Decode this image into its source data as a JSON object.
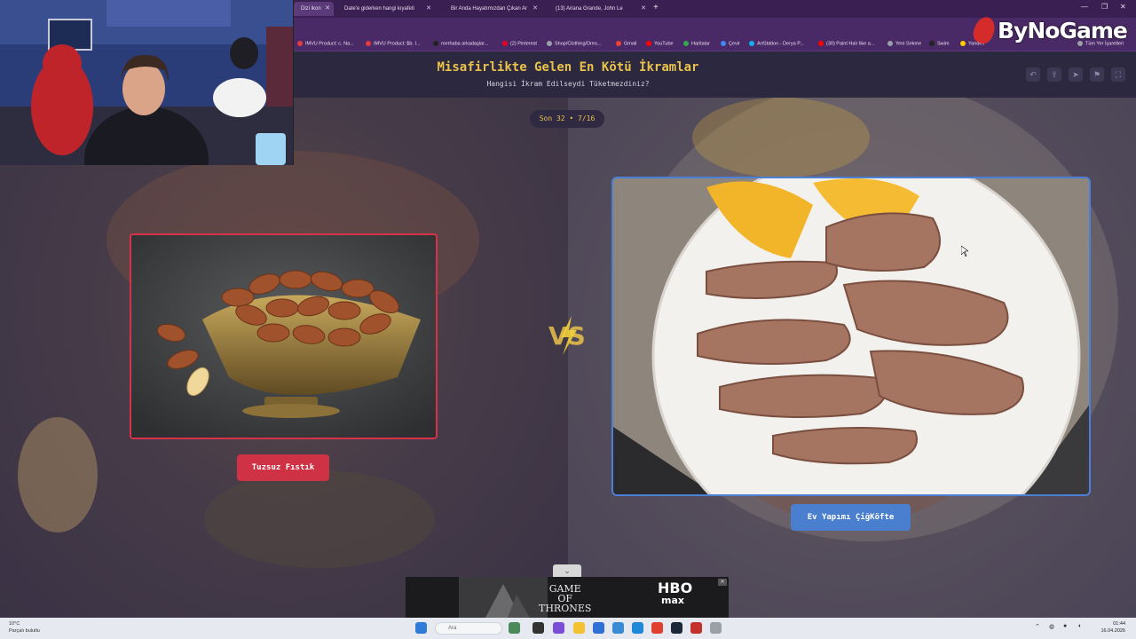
{
  "browser": {
    "tabs": [
      {
        "label": "Dizi ikon",
        "active": true
      },
      {
        "label": "Date'e giderken hangi kıyafeti",
        "active": false
      },
      {
        "label": "Bir Anda Hayatımızdan Çıkan Ar",
        "active": false
      },
      {
        "label": "(13) Ariana Grande, John Le",
        "active": false
      }
    ],
    "bookmarks": [
      {
        "label": "IMVU Product: c. Na...",
        "color": "#e23b3b"
      },
      {
        "label": "IMVU Product: $b. I...",
        "color": "#e23b3b"
      },
      {
        "label": "merhaba arkadaşlar...",
        "color": "#222222"
      },
      {
        "label": "(2) Pinterest",
        "color": "#e60023"
      },
      {
        "label": "Shop/Clothing/Dres...",
        "color": "#9aa0a6"
      },
      {
        "label": "Gmail",
        "color": "#ea4335"
      },
      {
        "label": "YouTube",
        "color": "#ff0000"
      },
      {
        "label": "Haritalar",
        "color": "#34a853"
      },
      {
        "label": "Çevir",
        "color": "#4285f4"
      },
      {
        "label": "ArtStation - Derya P...",
        "color": "#13aff0"
      },
      {
        "label": "(30) Paint Hair like a...",
        "color": "#ff0000"
      },
      {
        "label": "Yeni Sekme",
        "color": "#9aa0a6"
      },
      {
        "label": "Swim",
        "color": "#222222"
      },
      {
        "label": "Yandex",
        "color": "#ffcc00"
      },
      {
        "label": "Tüm Yer İşaretleri",
        "color": "#9aa0a6"
      }
    ]
  },
  "brand": {
    "text": "ByNoGame"
  },
  "quiz": {
    "title": "Misafirlikte Gelen En Kötü İkramlar",
    "subtitle": "Hangisi İkram Edilseydi Tüketmezdiniz?",
    "round": "Son 32 • 7/16",
    "left_option": "Tuzsuz Fıstık",
    "right_option": "Ev Yapımı ÇiğKöfte",
    "vs": "VS"
  },
  "ad": {
    "line1": "GAME",
    "line2": "OF",
    "line3": "THRONES",
    "hbo": "HBO",
    "max": "max"
  },
  "taskbar": {
    "weather_temp": "10°C",
    "weather_desc": "Parçalı bulutlu",
    "search": "Ara",
    "time": "01:44",
    "date": "16.04.2026"
  }
}
